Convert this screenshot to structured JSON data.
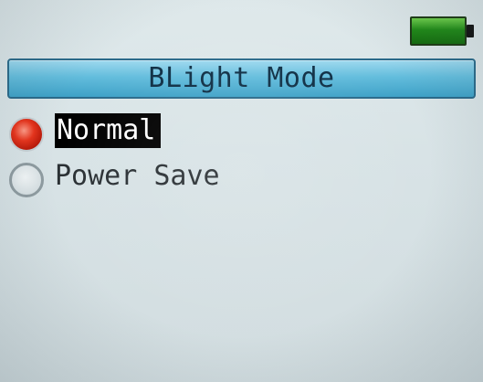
{
  "status": {
    "battery_icon": "battery-full-icon",
    "battery_color": "#1f8a16"
  },
  "title": "BLight Mode",
  "options": [
    {
      "label": "Normal",
      "selected": true
    },
    {
      "label": "Power Save",
      "selected": false
    }
  ],
  "colors": {
    "title_bar": "#63bddd",
    "radio_selected": "#e8341c",
    "selection_highlight": "#000000",
    "screen_background": "#d8e3e6"
  }
}
